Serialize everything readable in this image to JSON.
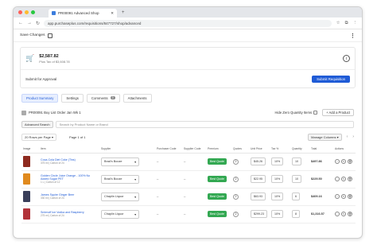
{
  "browser": {
    "tab_title": "PR00091 Advanced Shop",
    "url": "app.purchaseplus.com/requisitions/847727/shop/advanced",
    "dot_colors": [
      "#ff5f57",
      "#febc2e",
      "#28c840"
    ]
  },
  "toolbar": {
    "save_label": "Save Changes"
  },
  "summary": {
    "amount": "$2,587.82",
    "tax_text": "Plus Tax of $3,608.78",
    "submit_for_approval": "Submit for Approval",
    "submit_button": "Submit Requisition"
  },
  "tabs": [
    {
      "label": "Product Summary",
      "active": true
    },
    {
      "label": "Settings"
    },
    {
      "label": "Comments",
      "badge": "0"
    },
    {
      "label": "Attachments"
    }
  ],
  "list": {
    "title": "PR00091 Buy List Order Jan Wk 1",
    "hide_zero": "Hide Zero Quantity Items",
    "add_product": "+ Add a Product"
  },
  "search": {
    "advanced_label": "Advanced Search",
    "placeholder": "Search by Product Name or Brand"
  },
  "pager": {
    "rows_per_page": "20 Rows per Page",
    "page_text": "Page 1 of 1",
    "manage_columns": "Manage Columns"
  },
  "columns": [
    "Image",
    "Item",
    "Supplier",
    "Purchaser Code",
    "Supplier Code",
    "Premium",
    "Quotes",
    "Unit Price",
    "Tax %",
    "Quantity",
    "Total",
    "Actions"
  ],
  "rows": [
    {
      "img_color": "#8e2a1f",
      "name": "Coca-Cola Diet Coke (Tins)",
      "sub": "375 ml | Carton of 24",
      "supplier": "Brad's Booze",
      "pcode": "--",
      "scode": "--",
      "quote": "Best Quote",
      "quotes": "2",
      "unit_price": "$45.26",
      "tax": "10%",
      "qty": "10",
      "total": "$497.86"
    },
    {
      "img_color": "#e08a1e",
      "name": "Golden Circle Juice Orange - 100% No Added Sugar PET",
      "sub": "1 L | Carton of 12",
      "supplier": "Brad's Booze",
      "pcode": "--",
      "scode": "--",
      "quote": "Best Quote",
      "quotes": "2",
      "unit_price": "$22.95",
      "tax": "10%",
      "qty": "10",
      "total": "$229.50"
    },
    {
      "img_color": "#3a3f5a",
      "name": "James Squire Ginger Beer",
      "sub": "330 ml | Carton of 24",
      "supplier": "Chaplin Liquor",
      "pcode": "--",
      "scode": "--",
      "quote": "Best Quote",
      "quotes": "2",
      "unit_price": "$63.93",
      "tax": "10%",
      "qty": "6",
      "total": "$409.16"
    },
    {
      "img_color": "#b2333a",
      "name": "Smirnoff Ice Vodka and Raspberry",
      "sub": "275 ml | Carton of 24",
      "supplier": "Chaplin Liquor",
      "pcode": "--",
      "scode": "--",
      "quote": "Best Quote",
      "quotes": "2",
      "unit_price": "$299.23",
      "tax": "10%",
      "qty": "8",
      "total": "$1,316.57"
    }
  ]
}
